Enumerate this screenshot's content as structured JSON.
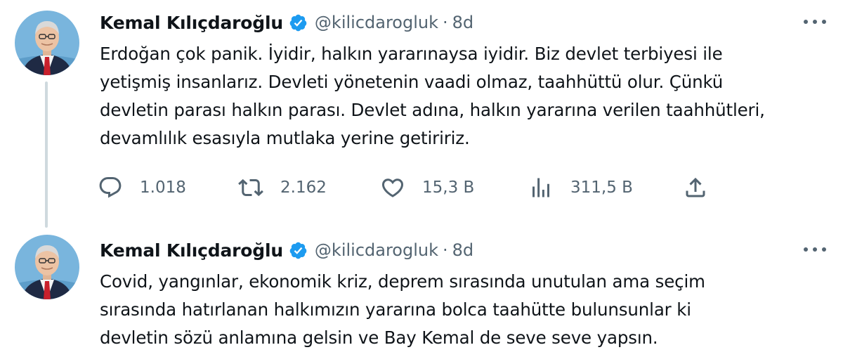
{
  "tweets": [
    {
      "author": {
        "name": "Kemal Kılıçdaroğlu",
        "handle": "@kilicdarogluk",
        "verified": true
      },
      "separator": "·",
      "time": "8d",
      "lines": [
        "Erdoğan çok panik. İyidir, halkın yararınaysa iyidir. Biz devlet terbiyesi ile",
        "yetişmiş insanlarız. Devleti yönetenin vaadi olmaz, taahhüttü olur. Çünkü",
        "devletin parası halkın parası. Devlet adına, halkın yararına verilen taahhütleri,",
        "devamlılık esasıyla mutlaka yerine getiririz."
      ],
      "stats": {
        "replies": "1.018",
        "retweets": "2.162",
        "likes": "15,3 B",
        "views": "311,5 B"
      }
    },
    {
      "author": {
        "name": "Kemal Kılıçdaroğlu",
        "handle": "@kilicdarogluk",
        "verified": true
      },
      "separator": "·",
      "time": "8d",
      "lines": [
        "Covid, yangınlar, ekonomik kriz, deprem sırasında unutulan ama seçim",
        "sırasında hatırlanan halkımızın yararına bolca taahütte bulunsunlar ki",
        "devletin sözü anlamına gelsin ve Bay Kemal de seve seve yapsın."
      ]
    }
  ],
  "icons": {
    "verified": "verified-badge-icon",
    "more": "more-icon",
    "reply": "reply-icon",
    "retweet": "retweet-icon",
    "like": "heart-icon",
    "views": "views-icon",
    "share": "share-icon"
  },
  "colors": {
    "text": "#0f1419",
    "secondary": "#536471",
    "verified": "#1d9bf0",
    "thread_line": "#cfd9de"
  }
}
